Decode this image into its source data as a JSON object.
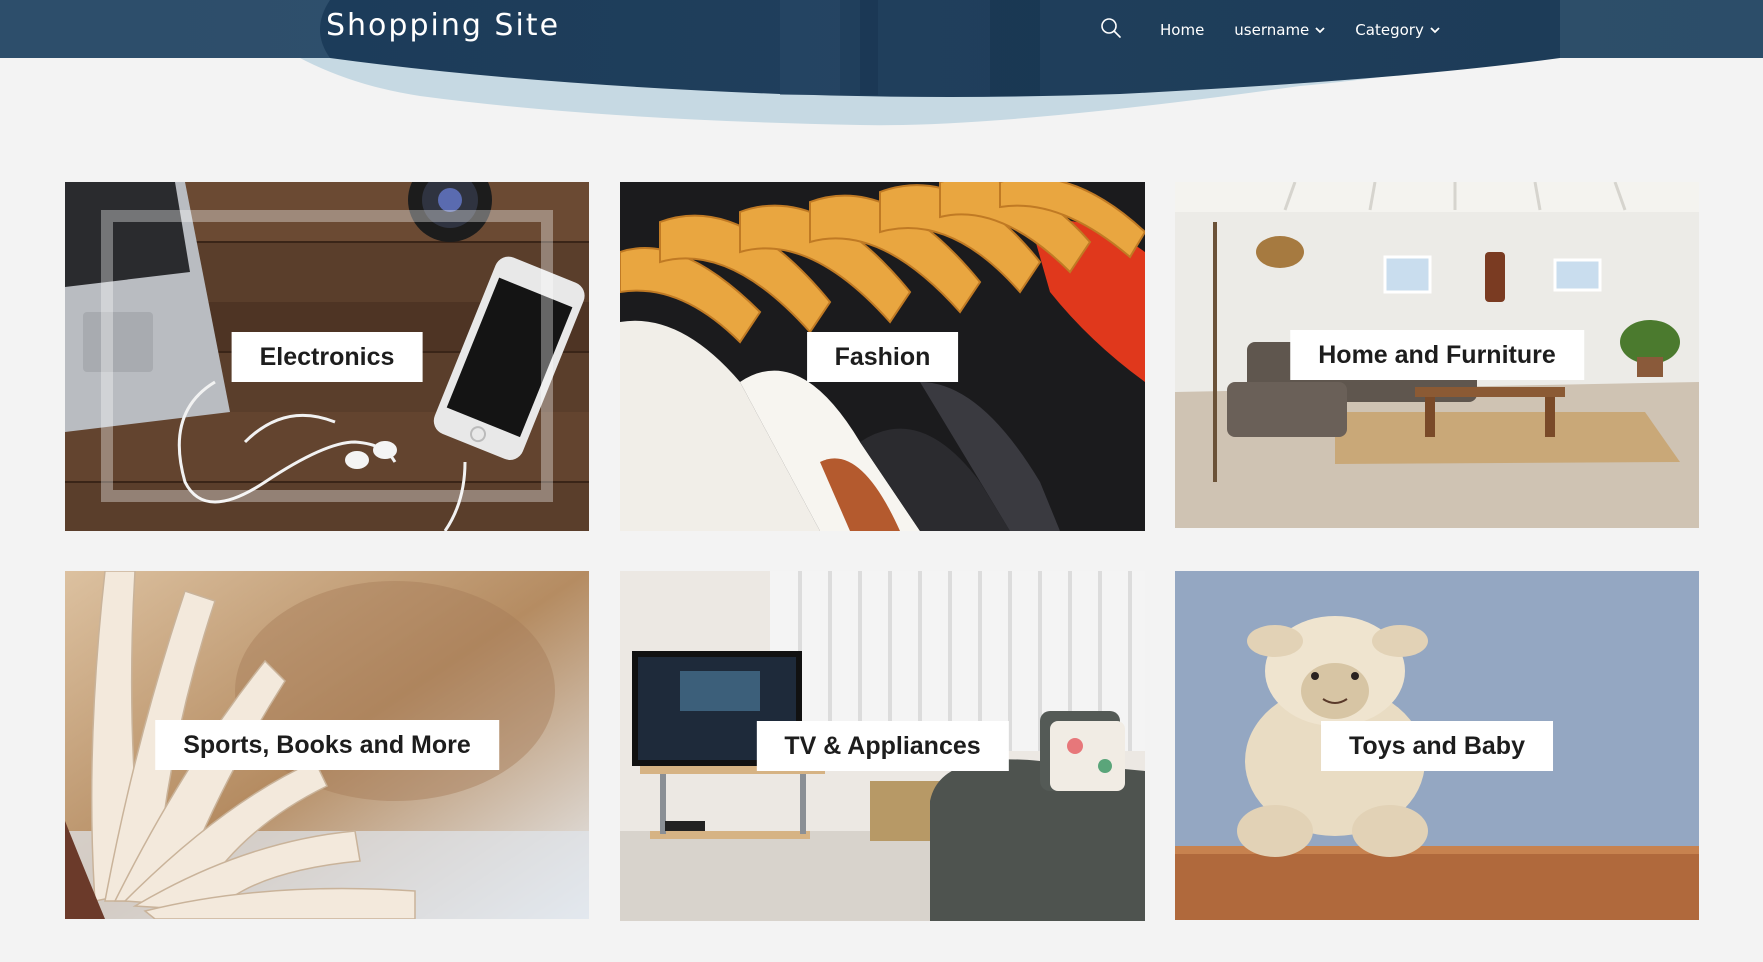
{
  "header": {
    "site_title": "Shopping Site",
    "nav": {
      "home": "Home",
      "user_menu": "username",
      "category_menu": "Category"
    },
    "colors": {
      "bar": "#1d3e5c",
      "wave_light": "#c6d9e3"
    }
  },
  "categories": [
    {
      "label": "Electronics",
      "image": "laptop, phone and earphones on wooden desk"
    },
    {
      "label": "Fashion",
      "image": "shirts on wooden hangers"
    },
    {
      "label": "Home and Furniture",
      "image": "living room with sofa and coffee table"
    },
    {
      "label": "Sports, Books and More",
      "image": "open book with fanned pages"
    },
    {
      "label": "TV & Appliances",
      "image": "TV on stand beside sofa"
    },
    {
      "label": "Toys and Baby",
      "image": "plush toy sheep on shelf"
    }
  ]
}
